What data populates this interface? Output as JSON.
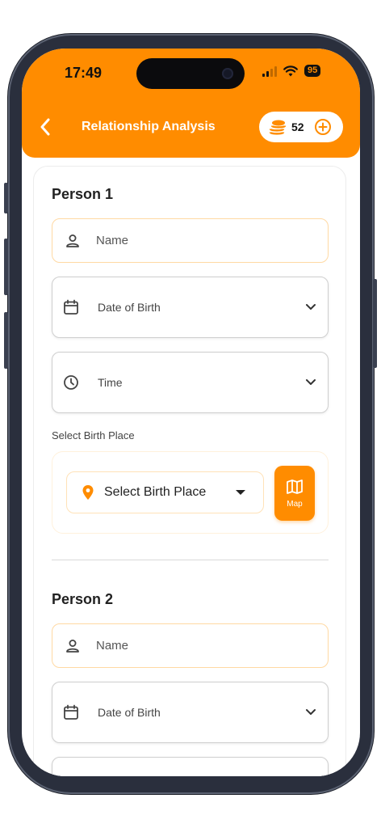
{
  "status_bar": {
    "time": "17:49",
    "battery": "95"
  },
  "header": {
    "title": "Relationship Analysis",
    "coins": "52"
  },
  "person1": {
    "title": "Person 1",
    "name_placeholder": "Name",
    "dob_label": "Date of Birth",
    "time_label": "Time",
    "birth_place_section_label": "Select Birth Place",
    "birth_place_select": "Select Birth Place",
    "map_button_label": "Map"
  },
  "person2": {
    "title": "Person 2",
    "name_placeholder": "Name",
    "dob_label": "Date of Birth"
  },
  "colors": {
    "accent": "#ff8c00",
    "name_border": "#ffd9a3",
    "text": "#222222"
  },
  "icons": [
    "back-icon",
    "coins-icon",
    "add-circle-icon",
    "person-icon",
    "calendar-icon",
    "clock-icon",
    "chevron-down-icon",
    "location-pin-icon",
    "map-icon"
  ]
}
